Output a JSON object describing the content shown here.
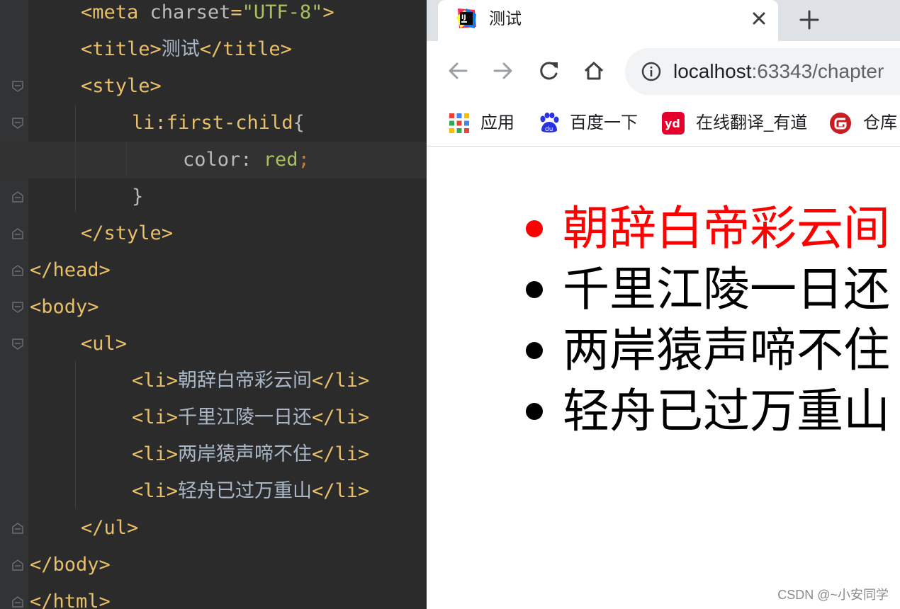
{
  "editor": {
    "lines": [
      {
        "id": "meta",
        "tokens": [
          {
            "c": "tag",
            "t": "<meta "
          },
          {
            "c": "attr",
            "t": "charset"
          },
          {
            "c": "tag",
            "t": "="
          },
          {
            "c": "str",
            "t": "\"UTF-8\""
          },
          {
            "c": "tag",
            "t": ">"
          }
        ]
      },
      {
        "id": "title",
        "tokens": [
          {
            "c": "tag",
            "t": "<title>"
          },
          {
            "c": "txt",
            "t": "测试"
          },
          {
            "c": "tag",
            "t": "</title>"
          }
        ]
      },
      {
        "id": "style-open",
        "tokens": [
          {
            "c": "tag",
            "t": "<style>"
          }
        ]
      },
      {
        "id": "selector",
        "tokens": [
          {
            "c": "tag",
            "t": "li:first-child"
          },
          {
            "c": "attr",
            "t": "{"
          }
        ]
      },
      {
        "id": "declaration",
        "tokens": [
          {
            "c": "prop",
            "t": "color"
          },
          {
            "c": "attr",
            "t": ": "
          },
          {
            "c": "val2",
            "t": "red"
          },
          {
            "c": "punct",
            "t": ";"
          }
        ]
      },
      {
        "id": "brace-close",
        "tokens": [
          {
            "c": "attr",
            "t": "}"
          }
        ]
      },
      {
        "id": "style-close",
        "tokens": [
          {
            "c": "tag",
            "t": "</style>"
          }
        ]
      },
      {
        "id": "head-close",
        "tokens": [
          {
            "c": "tag",
            "t": "</head>"
          }
        ]
      },
      {
        "id": "body-open",
        "tokens": [
          {
            "c": "tag",
            "t": "<body>"
          }
        ]
      },
      {
        "id": "ul-open",
        "tokens": [
          {
            "c": "tag",
            "t": "<ul>"
          }
        ]
      },
      {
        "id": "li-1",
        "tokens": [
          {
            "c": "tag",
            "t": "<li>"
          },
          {
            "c": "txt",
            "t": "朝辞白帝彩云间"
          },
          {
            "c": "tag",
            "t": "</li>"
          }
        ]
      },
      {
        "id": "li-2",
        "tokens": [
          {
            "c": "tag",
            "t": "<li>"
          },
          {
            "c": "txt",
            "t": "千里江陵一日还"
          },
          {
            "c": "tag",
            "t": "</li>"
          }
        ]
      },
      {
        "id": "li-3",
        "tokens": [
          {
            "c": "tag",
            "t": "<li>"
          },
          {
            "c": "txt",
            "t": "两岸猿声啼不住"
          },
          {
            "c": "tag",
            "t": "</li>"
          }
        ]
      },
      {
        "id": "li-4",
        "tokens": [
          {
            "c": "tag",
            "t": "<li>"
          },
          {
            "c": "txt",
            "t": "轻舟已过万重山"
          },
          {
            "c": "tag",
            "t": "</li>"
          }
        ]
      },
      {
        "id": "ul-close",
        "tokens": [
          {
            "c": "tag",
            "t": "</ul>"
          }
        ]
      },
      {
        "id": "body-close",
        "tokens": [
          {
            "c": "tag",
            "t": "</body>"
          }
        ]
      },
      {
        "id": "html-close",
        "tokens": [
          {
            "c": "tag",
            "t": "</html>"
          }
        ]
      }
    ]
  },
  "browser": {
    "tab": {
      "title": "测试",
      "icon": "intellij-icon",
      "close_icon": "close-icon"
    },
    "new_tab_icon": "plus-icon",
    "toolbar": {
      "back_icon": "back-arrow-icon",
      "forward_icon": "forward-arrow-icon",
      "reload_icon": "reload-icon",
      "home_icon": "home-icon"
    },
    "address": {
      "host": "localhost",
      "rest": ":63343/chapter",
      "info_icon": "info-icon"
    },
    "bookmarks": [
      {
        "label": "应用",
        "icon": "apps-grid-icon"
      },
      {
        "label": "百度一下",
        "icon": "baidu-paw-icon"
      },
      {
        "label": "在线翻译_有道",
        "icon": "youdao-icon"
      },
      {
        "label": "仓库",
        "icon": "gitee-icon"
      }
    ],
    "list_items": [
      "朝辞白帝彩云间",
      "千里江陵一日还",
      "两岸猿声啼不住",
      "轻舟已过万重山"
    ],
    "first_item_color": "#ff0000"
  },
  "watermark": "CSDN @~小安同学"
}
